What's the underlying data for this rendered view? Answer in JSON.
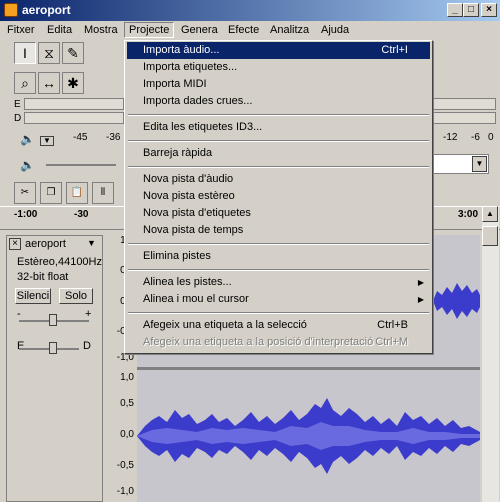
{
  "window": {
    "title": "aeroport",
    "minimize": "_",
    "maximize": "□",
    "close": "×"
  },
  "menubar": {
    "items": [
      "Fitxer",
      "Edita",
      "Mostra",
      "Projecte",
      "Genera",
      "Efecte",
      "Analitza",
      "Ajuda"
    ],
    "active": "Projecte"
  },
  "meters": {
    "left_label": "E",
    "right_label": "D",
    "ticks": [
      "-45",
      "-36",
      "-12",
      "-6",
      "0"
    ]
  },
  "ruler": {
    "labels": [
      "-1:00",
      "-30",
      "3:00"
    ]
  },
  "track": {
    "name": "aeroport",
    "format": "Estèreo,44100Hz",
    "bitdepth": "32-bit float",
    "mute": "Silenci",
    "solo": "Solo",
    "gain_minus": "-",
    "gain_plus": "+",
    "pan_left": "E",
    "pan_right": "D",
    "color": "#3c3ccc"
  },
  "scale_top": [
    "1,0",
    "0,5",
    "0,0",
    "-0,5",
    "-1,0"
  ],
  "scale_bottom": [
    "1,0",
    "0,5",
    "0,0",
    "-0,5",
    "-1,0"
  ],
  "project_menu": {
    "items": [
      {
        "label": "Importa àudio...",
        "shortcut": "Ctrl+I",
        "highlight": true
      },
      {
        "label": "Importa etiquetes..."
      },
      {
        "label": "Importa MIDI"
      },
      {
        "label": "Importa dades crues..."
      },
      {
        "label": "Edita les etiquetes ID3..."
      },
      {
        "label": "Barreja ràpida"
      },
      {
        "label": "Nova pista d'àudio"
      },
      {
        "label": "Nova pista estèreo"
      },
      {
        "label": "Nova pista d'etiquetes"
      },
      {
        "label": "Nova pista de temps"
      },
      {
        "label": "Elimina pistes"
      },
      {
        "label": "Alinea les pistes...",
        "submenu": true
      },
      {
        "label": "Alinea i mou el cursor",
        "submenu": true
      },
      {
        "label": "Afegeix una etiqueta a la selecció",
        "shortcut": "Ctrl+B"
      },
      {
        "label": "Afegeix una etiqueta a la posició d'interpretació",
        "shortcut": "Ctrl+M",
        "disabled": true
      }
    ]
  }
}
